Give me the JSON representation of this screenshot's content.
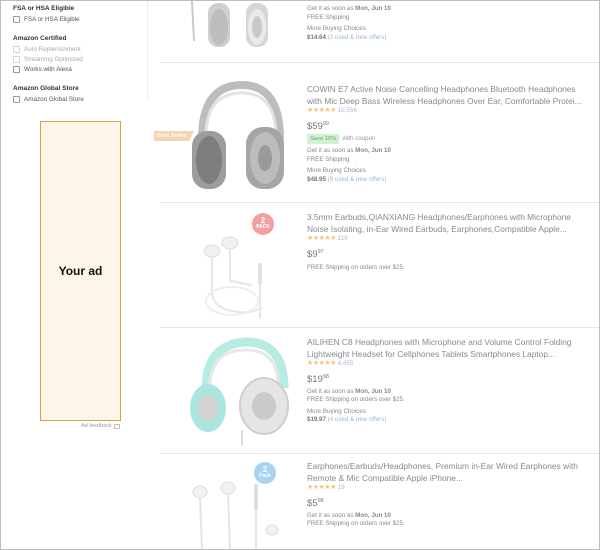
{
  "sidebar": {
    "fsa_heading": "FSA or HSA Eligible",
    "fsa_option": "FSA or HSA Eligible",
    "amazon_certified_heading": "Amazon Certified",
    "certified_options": [
      {
        "label": "Auto Replenishment",
        "disabled": true
      },
      {
        "label": "Streaming Optimized",
        "disabled": true
      },
      {
        "label": "Works with Alexa",
        "disabled": false
      }
    ],
    "global_store_heading": "Amazon Global Store",
    "global_store_option": "Amazon Global Store",
    "ad": {
      "text": "Your ad",
      "feedback_label": "Ad feedback"
    }
  },
  "results": [
    {
      "delivery_prefix": "Get it as soon as",
      "delivery_date": "Mon, Jun 10",
      "shipping": "FREE Shipping",
      "more_choices": "More Buying Choices",
      "more_price": "$14.64",
      "more_offers": "(2 used & new offers)"
    },
    {
      "badge": "Best Seller",
      "title": "COWIN E7 Active Noise Cancelling Headphones Bluetooth Headphones with Mic Deep Bass Wireless Headphones Over Ear, Comfortable Protei...",
      "stars": "★★★★★",
      "rating_count": "10,556",
      "price_whole": "$59",
      "price_fraction": "99",
      "coupon_badge": "Save 10%",
      "coupon_text": "with coupon",
      "delivery_prefix": "Get it as soon as",
      "delivery_date": "Mon, Jun 10",
      "shipping": "FREE Shipping",
      "more_choices": "More Buying Choices",
      "more_price": "$48.95",
      "more_offers": "(8 used & new offers)"
    },
    {
      "pack_number": "2",
      "pack_label": "PACK",
      "title": "3.5mm Earbuds,QIANXIANG Headphones/Earphones with Microphone Noise Isolating, in-Ear Wired Earbuds, Earphones,Compatible Apple...",
      "stars": "★★★★★",
      "rating_count": "119",
      "price_whole": "$9",
      "price_fraction": "97",
      "shipping": "FREE Shipping on orders over $25."
    },
    {
      "title": "AILIHEN C8 Headphones with Microphone and Volume Control Folding Lightweight Headset for Cellphones Tablets Smartphones Laptop...",
      "stars": "★★★★★",
      "rating_count": "4,455",
      "price_whole": "$19",
      "price_fraction": "98",
      "delivery_prefix": "Get it as soon as",
      "delivery_date": "Mon, Jun 10",
      "shipping": "FREE Shipping on orders over $25.",
      "more_choices": "More Buying Choices",
      "more_price": "$19.97",
      "more_offers": "(4 used & new offers)"
    },
    {
      "pack_number": "2",
      "pack_label": "Pack",
      "title": "Earphones/Earbuds/Headphones, Premium in-Ear Wired Earphones with Remote & Mic Compatible Apple iPhone...",
      "stars": "★★★★★",
      "rating_count": "19",
      "price_whole": "$5",
      "price_fraction": "98",
      "delivery_prefix": "Get it as soon as",
      "delivery_date": "Mon, Jun 10",
      "shipping": "FREE Shipping on orders over $25."
    }
  ]
}
